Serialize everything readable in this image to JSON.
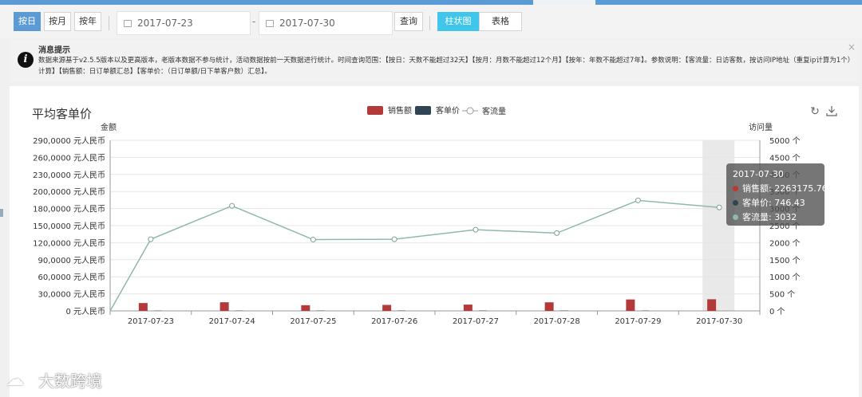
{
  "toolbar": {
    "by_day": "按日",
    "by_month": "按月",
    "by_year": "按年",
    "start_date": "2017-07-23",
    "dash": "-",
    "end_date": "2017-07-30",
    "query": "查询",
    "bar_chart": "柱状图",
    "table": "表格"
  },
  "notice": {
    "title": "消息提示",
    "text": "数据来源基于v2.5.5版本以及更高版本，老版本数据不参与统计，活动数据按前一天数据进行统计。时间查询范围：【按日：天数不能超过32天】【按月：月数不能超过12个月】【按年：年数不能超过7年】。参数说明：【客流量：日访客数，按访问IP地址（重复ip计算为1个）计算】【销售额：日订单额汇总】【客单价：（日订单额/日下单客户数）汇总】。",
    "close": "×"
  },
  "chart_title": "平均客单价",
  "colors": {
    "sales": "#b33a3a",
    "price": "#2f4554",
    "traffic": "#8fb8b0",
    "accent": "#5b9bd5"
  },
  "chart_data": {
    "type": "bar",
    "categories": [
      "2017-07-23",
      "2017-07-24",
      "2017-07-25",
      "2017-07-26",
      "2017-07-27",
      "2017-07-28",
      "2017-07-29",
      "2017-07-30"
    ],
    "series": [
      {
        "name": "销售额",
        "type": "bar",
        "axis": "left",
        "values": [
          138000,
          152000,
          100000,
          105000,
          111000,
          151000,
          201000,
          2263175.76
        ]
      },
      {
        "name": "客单价",
        "type": "bar",
        "axis": "left",
        "values": [
          4500,
          5000,
          5500,
          6000,
          6000,
          8000,
          8000,
          746.43
        ]
      },
      {
        "name": "客流量",
        "type": "line",
        "axis": "right",
        "values": [
          2100,
          3080,
          2090,
          2100,
          2380,
          2280,
          3240,
          3032
        ]
      }
    ],
    "ylabel_left": "金额",
    "ylabel_right": "访问量",
    "yticks_left": [
      "0  元人民币",
      "30,0000  元人民币",
      "60,0000  元人民币",
      "90,0000  元人民币",
      "120,0000  元人民币",
      "150,0000  元人民币",
      "180,0000  元人民币",
      "200,0000  元人民币",
      "230,0000  元人民币",
      "260,0000  元人民币",
      "290,0000  元人民币"
    ],
    "yticks_right": [
      "0  个",
      "500  个",
      "1000  个",
      "1500  个",
      "2000  个",
      "2500  个",
      "3000  个",
      "3500  个",
      "4000  个",
      "4500  个",
      "5000  个"
    ],
    "ylim_right": [
      0,
      5000
    ],
    "grid": true,
    "legend_position": "top-center",
    "tooltip": {
      "date": "2017-07-30",
      "rows": [
        {
          "label": "销售额: 2263175.76"
        },
        {
          "label": "客单价: 746.43"
        },
        {
          "label": "客流量: 3032"
        }
      ]
    }
  },
  "watermark": {
    "icon": "cloud-logo-icon",
    "text": "大数跨境"
  }
}
